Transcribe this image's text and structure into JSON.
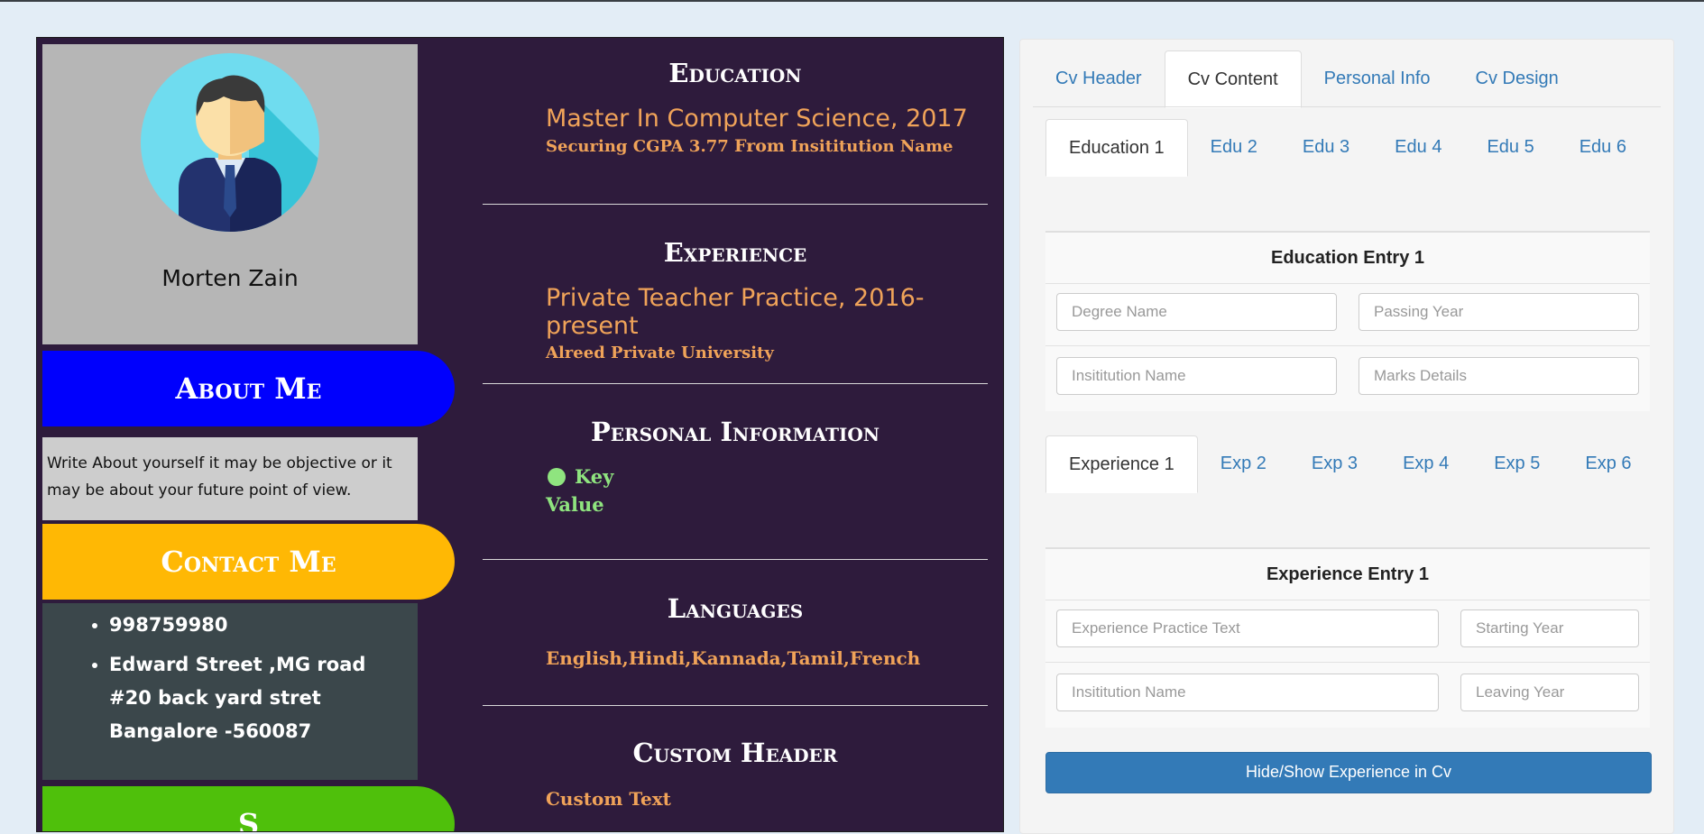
{
  "cv": {
    "name": "Morten Zain",
    "about_title": "About Me",
    "about_text": "Write About yourself it may be objective or it may be about your future point of view.",
    "contact_title": "Contact Me",
    "contact_items": [
      "998759980",
      "Edward Street ,MG road #20 back yard stret Bangalore -560087"
    ],
    "education": {
      "title": "Education",
      "line1": "Master In Computer Science, 2017",
      "line2_prefix": "Securing CGPA 3.77",
      "line2_from": "From",
      "line2_institution": "Insititution Name"
    },
    "experience": {
      "title": "Experience",
      "line1": "Private Teacher Practice, 2016- present",
      "line2": "Alreed Private University"
    },
    "personal": {
      "title": "Personal Information",
      "key": "Key",
      "value": "Value"
    },
    "languages": {
      "title": "Languages",
      "text": "English,Hindi,Kannada,Tamil,French"
    },
    "custom": {
      "title": "Custom Header",
      "text": "Custom Text"
    }
  },
  "editor": {
    "main_tabs": [
      "Cv Header",
      "Cv Content",
      "Personal Info",
      "Cv Design"
    ],
    "active_main_tab": "Cv Content",
    "edu_tabs": [
      "Education 1",
      "Edu 2",
      "Edu 3",
      "Edu 4",
      "Edu 5",
      "Edu 6"
    ],
    "edu_entry_title": "Education Entry 1",
    "edu_fields": {
      "degree_placeholder": "Degree Name",
      "year_placeholder": "Passing Year",
      "institution_placeholder": "Insititution Name",
      "marks_placeholder": "Marks Details"
    },
    "exp_tabs": [
      "Experience 1",
      "Exp 2",
      "Exp 3",
      "Exp 4",
      "Exp 5",
      "Exp 6"
    ],
    "exp_entry_title": "Experience Entry 1",
    "exp_fields": {
      "practice_placeholder": "Experience Practice Text",
      "start_placeholder": "Starting Year",
      "institution_placeholder": "Insititution Name",
      "leave_placeholder": "Leaving Year"
    },
    "toggle_button": "Hide/Show Experience in Cv"
  },
  "colors": {
    "cv_background": "#2e1b3c",
    "about_pill": "#0000fd",
    "contact_pill": "#ffb804",
    "skills_pill": "#4fc00b",
    "accent_text": "#f0a359",
    "key_value_text": "#8fe47f",
    "link_blue": "#337ab7"
  },
  "icons": {
    "avatar": "person-avatar-icon",
    "bullet": "bullet-dot-icon"
  }
}
